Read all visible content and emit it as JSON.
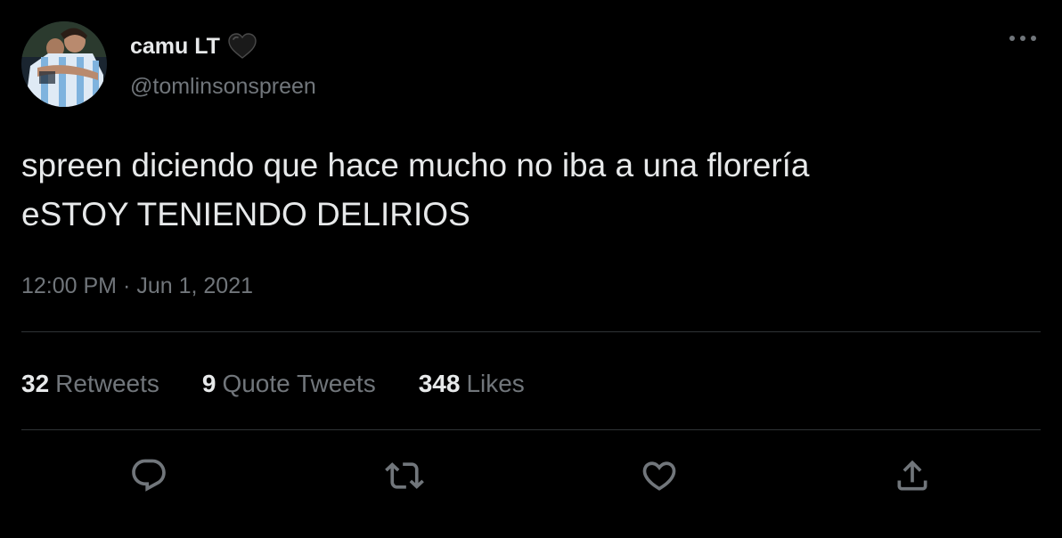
{
  "author": {
    "display_name": "camu LT",
    "name_emoji": "black-heart-icon",
    "handle": "@tomlinsonspreen"
  },
  "tweet": {
    "text": "spreen diciendo que hace mucho no iba a una florería\neSTOY TENIENDO DELIRIOS",
    "time": "12:00 PM",
    "separator": "·",
    "date": "Jun 1, 2021"
  },
  "stats": {
    "retweets_count": "32",
    "retweets_label": "Retweets",
    "quotes_count": "9",
    "quotes_label": "Quote Tweets",
    "likes_count": "348",
    "likes_label": "Likes"
  },
  "actions": [
    "reply-icon",
    "retweet-icon",
    "like-icon",
    "share-icon"
  ],
  "colors": {
    "background": "#000000",
    "primary_text": "#e7e9ea",
    "secondary_text": "#71767b",
    "divider": "#2f3336"
  }
}
